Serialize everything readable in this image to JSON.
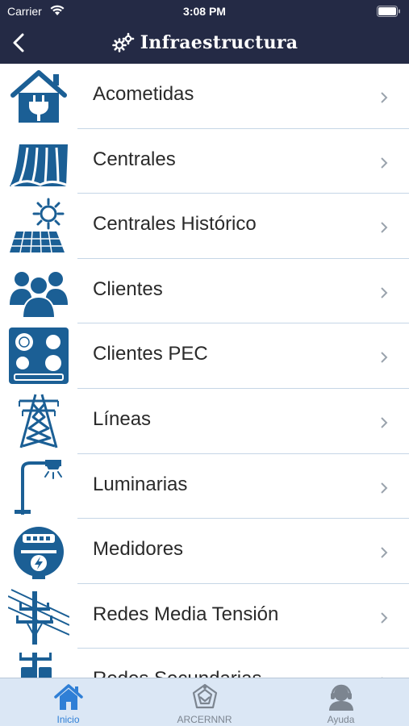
{
  "status_bar": {
    "carrier": "Carrier",
    "time": "3:08 PM"
  },
  "nav": {
    "title": "Infraestructura",
    "back_icon": "chevron-left-icon",
    "title_icon": "gears-icon"
  },
  "colors": {
    "header": "#242a45",
    "icon_blue": "#1b5f95",
    "tab_active": "#2f7fd6",
    "tab_inactive": "#7c8590",
    "tab_bg": "#dbe7f5"
  },
  "list": {
    "items": [
      {
        "label": "Acometidas",
        "icon": "house-plug-icon"
      },
      {
        "label": "Centrales",
        "icon": "dam-icon"
      },
      {
        "label": "Centrales Histórico",
        "icon": "solar-panel-icon"
      },
      {
        "label": "Clientes",
        "icon": "people-icon"
      },
      {
        "label": "Clientes PEC",
        "icon": "induction-stove-icon"
      },
      {
        "label": "Líneas",
        "icon": "transmission-tower-icon"
      },
      {
        "label": "Luminarias",
        "icon": "street-light-icon"
      },
      {
        "label": "Medidores",
        "icon": "meter-icon"
      },
      {
        "label": "Redes Media Tensión",
        "icon": "power-pole-icon"
      },
      {
        "label": "Redes Secundarias",
        "icon": "distribution-pole-icon"
      }
    ]
  },
  "tabs": [
    {
      "label": "Inicio",
      "icon": "home-icon",
      "active": true
    },
    {
      "label": "ARCERNNR",
      "icon": "arcernnr-logo-icon",
      "active": false
    },
    {
      "label": "Ayuda",
      "icon": "support-agent-icon",
      "active": false
    }
  ]
}
